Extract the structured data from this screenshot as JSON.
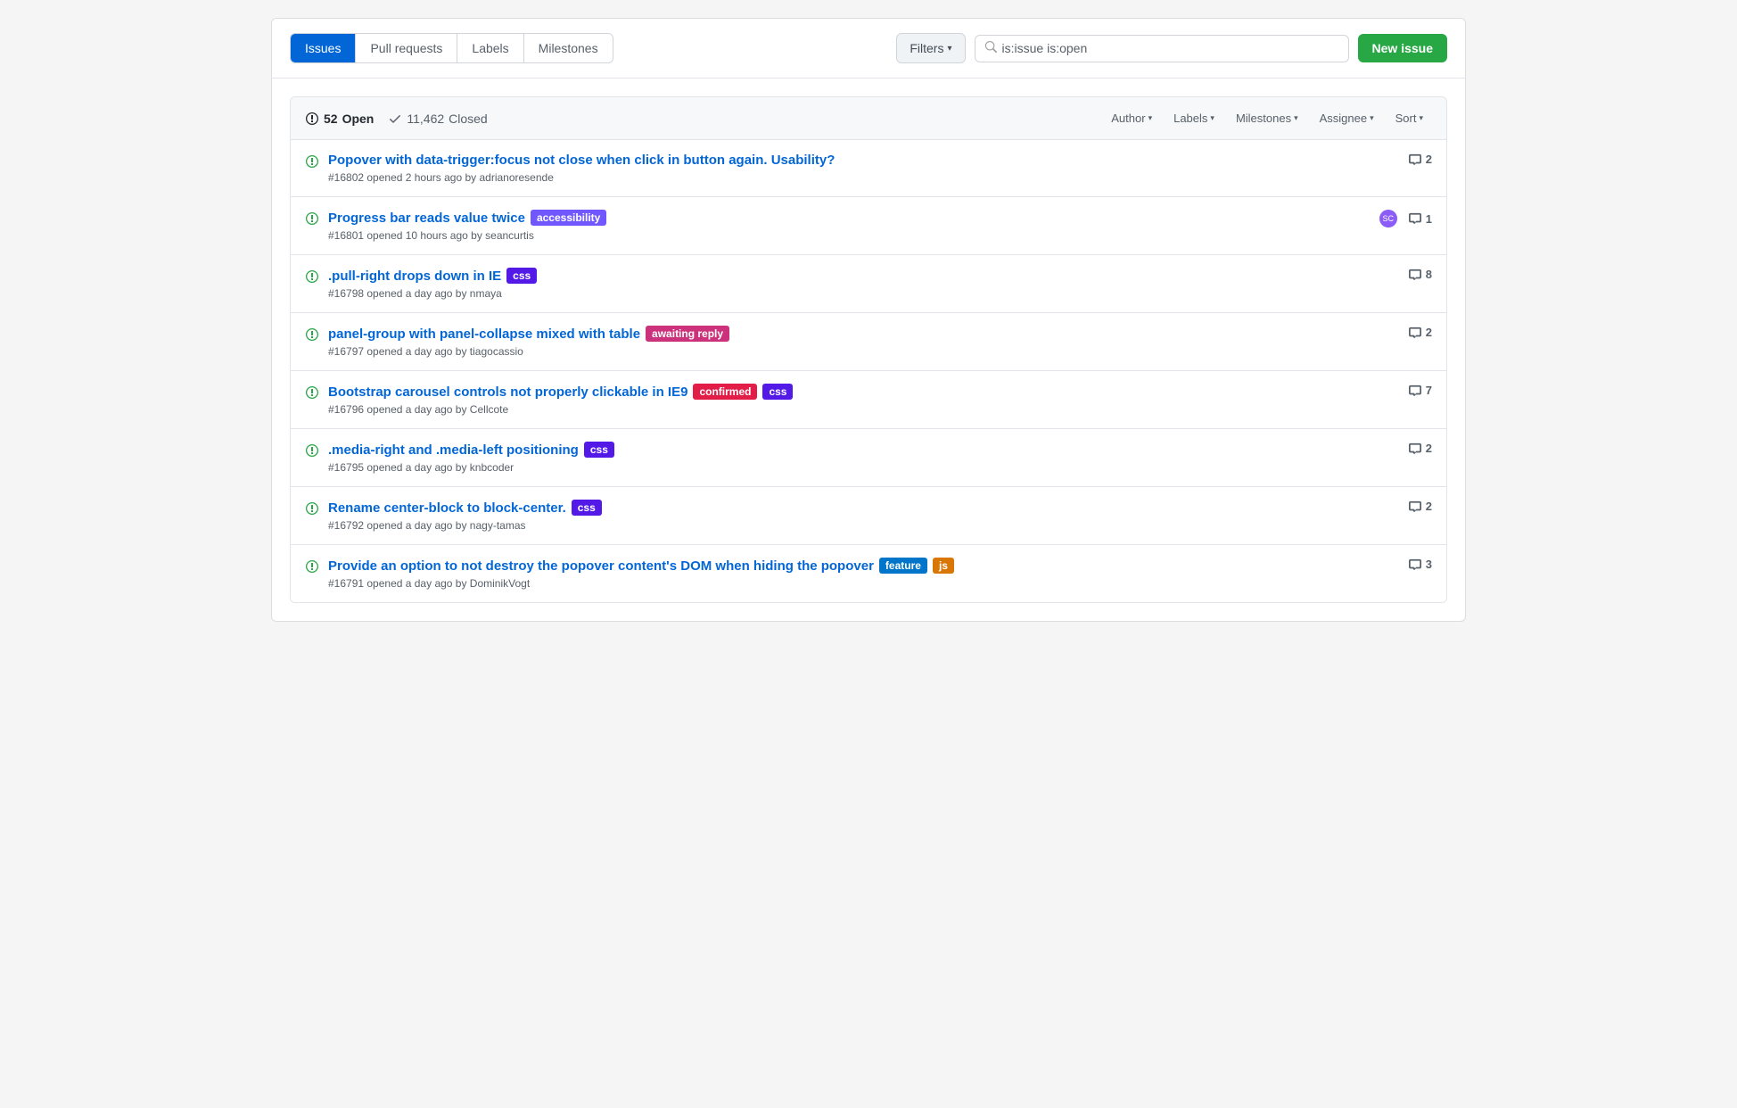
{
  "tabs": [
    {
      "label": "Issues",
      "active": true,
      "id": "issues"
    },
    {
      "label": "Pull requests",
      "active": false,
      "id": "pull-requests"
    },
    {
      "label": "Labels",
      "active": false,
      "id": "labels"
    },
    {
      "label": "Milestones",
      "active": false,
      "id": "milestones"
    }
  ],
  "search": {
    "filters_label": "Filters",
    "placeholder": "is:issue is:open",
    "value": "is:issue is:open"
  },
  "new_issue_label": "New issue",
  "counts": {
    "open_count": "52",
    "open_label": "Open",
    "closed_count": "11,462",
    "closed_label": "Closed"
  },
  "filter_dropdowns": [
    {
      "label": "Author",
      "id": "author"
    },
    {
      "label": "Labels",
      "id": "labels"
    },
    {
      "label": "Milestones",
      "id": "milestones"
    },
    {
      "label": "Assignee",
      "id": "assignee"
    },
    {
      "label": "Sort",
      "id": "sort"
    }
  ],
  "issues": [
    {
      "id": "issue-16802",
      "number": "#16802",
      "title": "Popover with data-trigger:focus not close when click in button again. Usability?",
      "meta": "opened 2 hours ago by adrianoresende",
      "labels": [],
      "comments": 2,
      "has_avatar": false,
      "avatar_initials": ""
    },
    {
      "id": "issue-16801",
      "number": "#16801",
      "title": "Progress bar reads value twice",
      "meta": "opened 10 hours ago by seancurtis",
      "labels": [
        {
          "text": "accessibility",
          "class": "label-accessibility"
        }
      ],
      "comments": 1,
      "has_avatar": true,
      "avatar_initials": "SC"
    },
    {
      "id": "issue-16798",
      "number": "#16798",
      "title": ".pull-right drops down in IE",
      "meta": "opened a day ago by nmaya",
      "labels": [
        {
          "text": "css",
          "class": "label-css"
        }
      ],
      "comments": 8,
      "has_avatar": false,
      "avatar_initials": ""
    },
    {
      "id": "issue-16797",
      "number": "#16797",
      "title": "panel-group with panel-collapse mixed with table",
      "meta": "opened a day ago by tiagocassio",
      "labels": [
        {
          "text": "awaiting reply",
          "class": "label-awaiting-reply"
        }
      ],
      "comments": 2,
      "has_avatar": false,
      "avatar_initials": ""
    },
    {
      "id": "issue-16796",
      "number": "#16796",
      "title": "Bootstrap carousel controls not properly clickable in IE9",
      "meta": "opened a day ago by Cellcote",
      "labels": [
        {
          "text": "confirmed",
          "class": "label-confirmed"
        },
        {
          "text": "css",
          "class": "label-css"
        }
      ],
      "comments": 7,
      "has_avatar": false,
      "avatar_initials": ""
    },
    {
      "id": "issue-16795",
      "number": "#16795",
      "title": ".media-right and .media-left positioning",
      "meta": "opened a day ago by knbcoder",
      "labels": [
        {
          "text": "css",
          "class": "label-css"
        }
      ],
      "comments": 2,
      "has_avatar": false,
      "avatar_initials": ""
    },
    {
      "id": "issue-16792",
      "number": "#16792",
      "title": "Rename center-block to block-center.",
      "meta": "opened a day ago by nagy-tamas",
      "labels": [
        {
          "text": "css",
          "class": "label-css"
        }
      ],
      "comments": 2,
      "has_avatar": false,
      "avatar_initials": ""
    },
    {
      "id": "issue-16791",
      "number": "#16791",
      "title": "Provide an option to not destroy the popover content's DOM when hiding the popover",
      "meta": "opened a day ago by DominikVogt",
      "labels": [
        {
          "text": "feature",
          "class": "label-feature"
        },
        {
          "text": "js",
          "class": "label-js"
        }
      ],
      "comments": 3,
      "has_avatar": false,
      "avatar_initials": ""
    }
  ]
}
